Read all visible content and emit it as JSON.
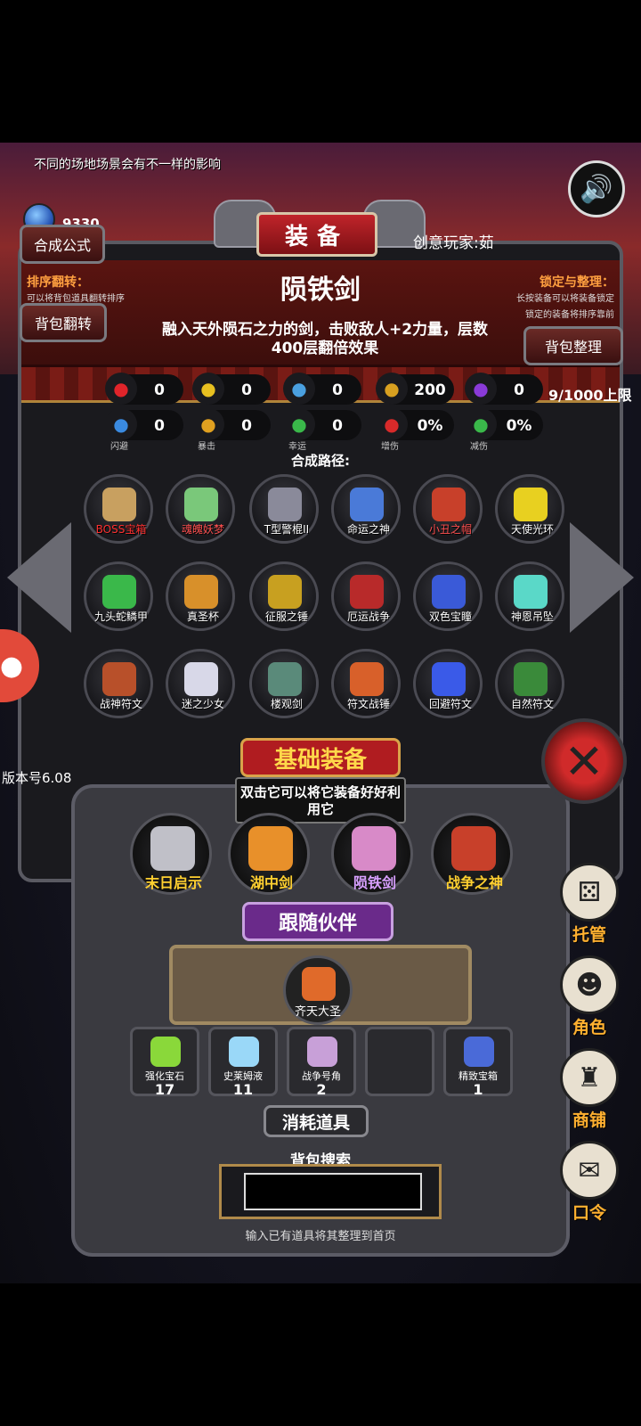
{
  "header": {
    "hint": "不同的场地场景会有不一样的影响",
    "gem_count": "9330",
    "craft_button": "合成公式",
    "title": "装备",
    "player": "创意玩家:茹"
  },
  "sort_panel": {
    "title": "排序翻转：",
    "desc": "可以将背包道具翻转排序",
    "button": "背包翻转"
  },
  "lock_panel": {
    "title": "锁定与整理：",
    "desc1": "长按装备可以将装备锁定",
    "desc2": "锁定的装备将排序靠前",
    "button": "背包整理"
  },
  "item": {
    "name": "陨铁剑",
    "description": "融入天外陨石之力的剑，击败敌人+2力量，层数400层翻倍效果",
    "limit": "9/1000上限"
  },
  "stats_row1": [
    {
      "icon": "heart-icon",
      "value": "0",
      "color": "#e0242a"
    },
    {
      "icon": "armor-icon",
      "value": "0",
      "color": "#e8c020"
    },
    {
      "icon": "helmet-icon",
      "value": "0",
      "color": "#4aa0e0"
    },
    {
      "icon": "strength-icon",
      "value": "200",
      "color": "#d8a020"
    },
    {
      "icon": "lightning-icon",
      "value": "0",
      "color": "#8a3ad8"
    }
  ],
  "stats_row2": [
    {
      "icon": "dodge-icon",
      "value": "0",
      "label": "闪避",
      "color": "#3a8ae0"
    },
    {
      "icon": "crit-icon",
      "value": "0",
      "label": "暴击",
      "color": "#e0a020"
    },
    {
      "icon": "luck-icon",
      "value": "0",
      "label": "幸运",
      "color": "#3ab84a"
    },
    {
      "icon": "damage-up-icon",
      "value": "0%",
      "label": "增伤",
      "color": "#d82a2a"
    },
    {
      "icon": "damage-reduce-icon",
      "value": "0%",
      "label": "减伤",
      "color": "#3ab84a"
    }
  ],
  "craft_path": {
    "label": "合成路径:",
    "items": [
      {
        "name": "BOSS宝箱",
        "color": "#c8a060",
        "label_color": "#ff3030"
      },
      {
        "name": "魂魄妖梦",
        "color": "#7ac87a",
        "label_color": "#ff5050"
      },
      {
        "name": "T型警棍II",
        "color": "#8a8a9a",
        "label_color": "#ffffff"
      },
      {
        "name": "命运之神",
        "color": "#4a7ad8",
        "label_color": "#ffffff"
      },
      {
        "name": "小丑之帽",
        "color": "#c8402a",
        "label_color": "#ff5050"
      },
      {
        "name": "天使光环",
        "color": "#e8d020",
        "label_color": "#ffffff"
      },
      {
        "name": "九头蛇鳞甲",
        "color": "#3ab84a",
        "label_color": "#ffffff"
      },
      {
        "name": "真圣杯",
        "color": "#d8902a",
        "label_color": "#ffffff"
      },
      {
        "name": "征服之锤",
        "color": "#c8a020",
        "label_color": "#ffffff"
      },
      {
        "name": "厄运战争",
        "color": "#b82a2a",
        "label_color": "#ffffff"
      },
      {
        "name": "双色宝瞳",
        "color": "#3a5ad8",
        "label_color": "#ffffff"
      },
      {
        "name": "神恩吊坠",
        "color": "#5ad8c8",
        "label_color": "#ffffff"
      },
      {
        "name": "战神符文",
        "color": "#b8502a",
        "label_color": "#ffffff"
      },
      {
        "name": "迷之少女",
        "color": "#d8d8e8",
        "label_color": "#ffffff"
      },
      {
        "name": "楼观剑",
        "color": "#5a8a7a",
        "label_color": "#ffffff"
      },
      {
        "name": "符文战锤",
        "color": "#d8602a",
        "label_color": "#ffffff"
      },
      {
        "name": "回避符文",
        "color": "#3a5ae8",
        "label_color": "#ffffff"
      },
      {
        "name": "自然符文",
        "color": "#3a8a3a",
        "label_color": "#ffffff"
      }
    ]
  },
  "base_equipment": {
    "title": "基础装备",
    "note": "双击它可以将它装备好好利用它",
    "items": [
      {
        "name": "末日启示",
        "color": "#c0c0c8",
        "label_color": "#ffd030"
      },
      {
        "name": "湖中剑",
        "color": "#e8902a",
        "label_color": "#ffd030"
      },
      {
        "name": "陨铁剑",
        "color": "#d88ac8",
        "label_color": "#d8a0ff"
      },
      {
        "name": "战争之神",
        "color": "#c8402a",
        "label_color": "#ffd030"
      }
    ]
  },
  "partner": {
    "title": "跟随伙伴",
    "name": "齐天大圣",
    "color": "#e06a2a"
  },
  "consumables": {
    "title": "消耗道具",
    "items": [
      {
        "name": "强化宝石",
        "count": "17",
        "color": "#8ad83a"
      },
      {
        "name": "史莱姆液",
        "count": "11",
        "color": "#9ad8f8"
      },
      {
        "name": "战争号角",
        "count": "2",
        "color": "#c8a0d8"
      },
      {
        "name": "",
        "count": "",
        "color": ""
      },
      {
        "name": "精致宝箱",
        "count": "1",
        "color": "#4a6ad8"
      }
    ]
  },
  "search": {
    "label": "背包搜索",
    "value": "",
    "tip": "输入已有道具将其整理到首页"
  },
  "version": "版本号6.08",
  "side_menu": [
    {
      "label": "托管",
      "icon": "dice-icon",
      "glyph": "⚄"
    },
    {
      "label": "角色",
      "icon": "hooded-character-icon",
      "glyph": "☻"
    },
    {
      "label": "商铺",
      "icon": "shop-icon",
      "glyph": "♜"
    },
    {
      "label": "口令",
      "icon": "scroll-icon",
      "glyph": "✉"
    }
  ]
}
